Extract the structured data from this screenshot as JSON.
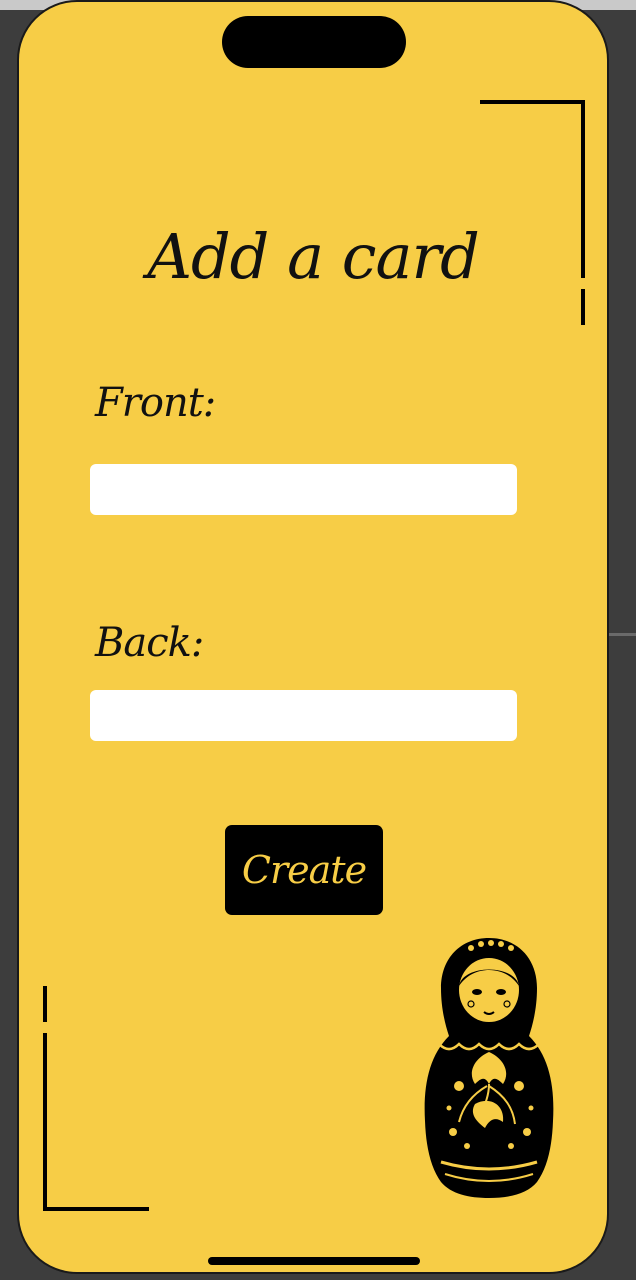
{
  "screen": {
    "title": "Add a card"
  },
  "form": {
    "front_label": "Front:",
    "front_value": "",
    "back_label": "Back:",
    "back_value": "",
    "create_label": "Create"
  },
  "decoration": {
    "doll_icon": "matryoshka-doll-icon"
  },
  "colors": {
    "background": "#f7cd46",
    "accent": "#000000",
    "button_text": "#f7cd46",
    "field": "#ffffff"
  }
}
